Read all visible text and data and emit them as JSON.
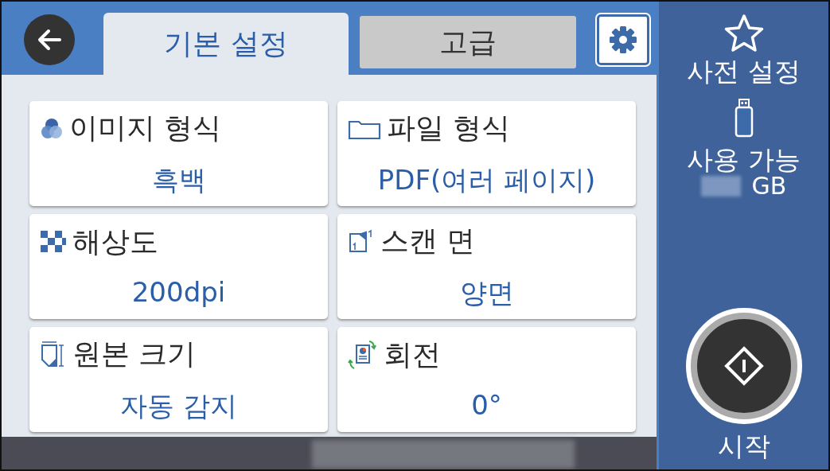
{
  "tabs": [
    {
      "label": "기본 설정",
      "selected": true
    },
    {
      "label": "고급",
      "selected": false
    }
  ],
  "settings": [
    {
      "label": "이미지 형식",
      "value": "흑백"
    },
    {
      "label": "파일 형식",
      "value": "PDF(여러 페이지)"
    },
    {
      "label": "해상도",
      "value": "200dpi"
    },
    {
      "label": "스캔 면",
      "value": "양면"
    },
    {
      "label": "원본 크기",
      "value": "자동 감지"
    },
    {
      "label": "회전",
      "value": "0°"
    }
  ],
  "side_panel": {
    "presets_label": "사전 설정",
    "storage_label": "사용 가능",
    "storage_unit": "GB",
    "start_label": "시작"
  }
}
